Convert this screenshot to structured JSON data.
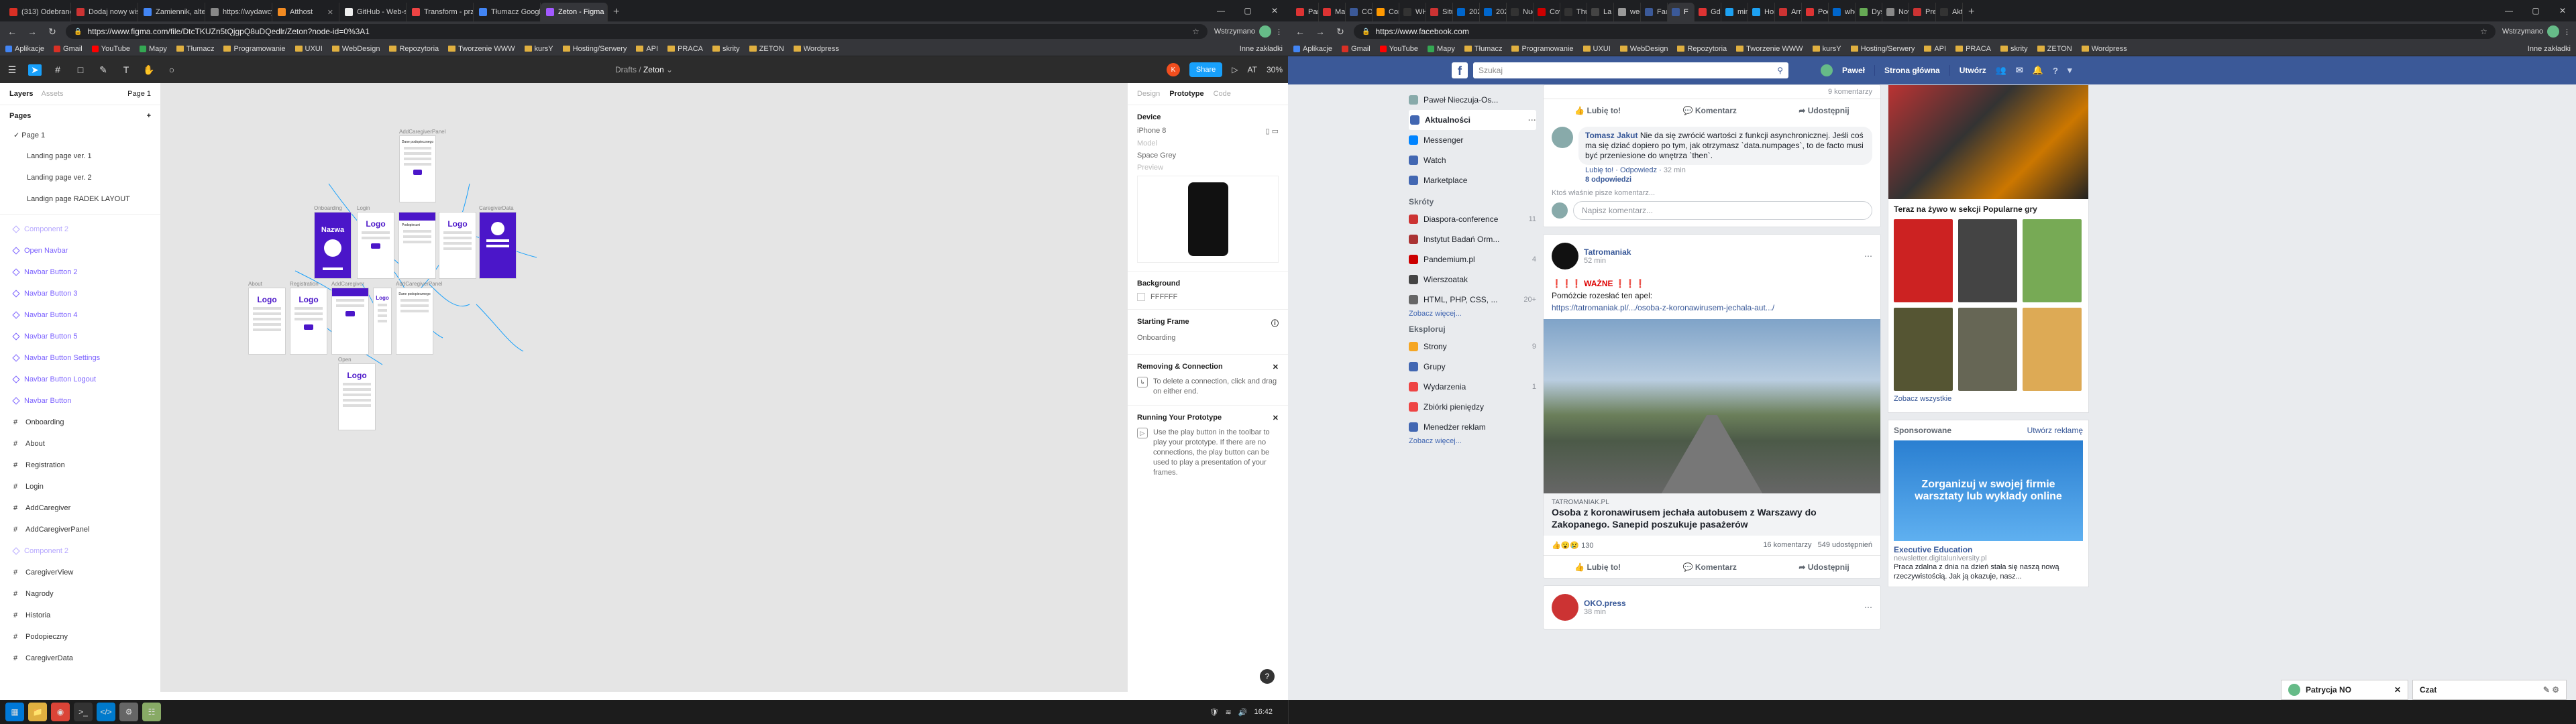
{
  "left_browser": {
    "tabs": [
      {
        "label": "(313) Odebrane - Listy",
        "color": "#d93025"
      },
      {
        "label": "Dodaj nowy wiś • Pas",
        "color": "#c33"
      },
      {
        "label": "Zamiennik, alternatyw",
        "color": "#4285f4"
      },
      {
        "label": "https://wydawcy.panel",
        "color": "#888"
      },
      {
        "label": "Atthost",
        "color": "#f28b22"
      },
      {
        "label": "GitHub - Web-skirport",
        "color": "#eee"
      },
      {
        "label": "Transform - przekszta",
        "color": "#e44"
      },
      {
        "label": "Tłumacz Google",
        "color": "#4285f4"
      },
      {
        "label": "Zeton - Figma",
        "color": "#a259ff",
        "active": true
      }
    ],
    "url": "https://www.figma.com/file/DtcTKUZn5tQjgpQ8uDQedlr/Zeton?node-id=0%3A1",
    "profile_label": "Wstrzymano",
    "bookmarks": [
      "Aplikacje",
      "Gmail",
      "YouTube",
      "Mapy",
      "Tłumacz",
      "Programowanie",
      "UXUI",
      "WebDesign",
      "Repozytoria",
      "Tworzenie WWW",
      "kursY",
      "Hosting/Serwery",
      "API",
      "PRACA",
      "skrity",
      "ZETON",
      "Wordpress"
    ],
    "bookmarks_right": "Inne zakładki"
  },
  "figma": {
    "breadcrumb_parent": "Drafts",
    "breadcrumb_current": "Zeton",
    "avatar_initial": "K",
    "share_label": "Share",
    "user_initials": "AT",
    "zoom": "30%",
    "layers_tab": "Layers",
    "assets_tab": "Assets",
    "page_selector": "Page 1",
    "pages_heading": "Pages",
    "pages": [
      "Page 1",
      "Landing page ver. 1",
      "Landing page ver. 2",
      "Landign page RADEK LAYOUT"
    ],
    "layers": [
      {
        "label": "Component 2",
        "type": "comp-dim"
      },
      {
        "label": "Open Navbar",
        "type": "comp"
      },
      {
        "label": "Navbar Button 2",
        "type": "comp"
      },
      {
        "label": "Navbar Button 3",
        "type": "comp"
      },
      {
        "label": "Navbar Button 4",
        "type": "comp"
      },
      {
        "label": "Navbar Button 5",
        "type": "comp"
      },
      {
        "label": "Navbar Button Settings",
        "type": "comp"
      },
      {
        "label": "Navbar Button Logout",
        "type": "comp"
      },
      {
        "label": "Navbar Button",
        "type": "comp"
      },
      {
        "label": "Onboarding",
        "type": "frame"
      },
      {
        "label": "About",
        "type": "frame"
      },
      {
        "label": "Registration",
        "type": "frame"
      },
      {
        "label": "Login",
        "type": "frame"
      },
      {
        "label": "AddCaregiver",
        "type": "frame"
      },
      {
        "label": "AddCaregiverPanel",
        "type": "frame"
      },
      {
        "label": "Component 2",
        "type": "comp-dim"
      },
      {
        "label": "CaregiverView",
        "type": "frame"
      },
      {
        "label": "Nagrody",
        "type": "frame"
      },
      {
        "label": "Historia",
        "type": "frame"
      },
      {
        "label": "Podopieczny",
        "type": "frame"
      },
      {
        "label": "CaregiverData",
        "type": "frame"
      }
    ],
    "right_tabs": [
      "Design",
      "Prototype",
      "Code"
    ],
    "device_heading": "Device",
    "device": "iPhone 8",
    "model_label": "Model",
    "model_value": "Space Grey",
    "preview_label": "Preview",
    "background_heading": "Background",
    "background_value": "FFFFFF",
    "starting_frame_heading": "Starting Frame",
    "starting_frame_value": "Onboarding",
    "removing_heading": "Removing & Connection",
    "removing_text": "To delete a connection, click and drag on either end.",
    "running_heading": "Running Your Prototype",
    "running_text": "Use the play button in the toolbar to play your prototype. If there are no connections, the play button can be used to play a presentation of your frames.",
    "frame_labels": {
      "onboarding": "Onboarding",
      "login": "Login",
      "caregiver_data": "CaregiverData",
      "about": "About",
      "registration": "Registration",
      "add_caregiver": "AddCaregiver",
      "add_caregiver_panel": "AddCaregiverPanel",
      "add_caregiver_panel_top": "AddCaregiverPanel",
      "open_navbar": "Open"
    },
    "frame_texts": {
      "nazwa": "Nazwa",
      "logo": "Logo",
      "podopieczni": "Podopieczni",
      "dane": "Dane podopiecznego"
    }
  },
  "taskbar": {
    "time": "16:42",
    "apps": [
      "start",
      "files",
      "chrome",
      "terminal",
      "vscode",
      "explorer",
      "settings"
    ]
  },
  "right_browser": {
    "tabs": [
      {
        "label": "Pan",
        "color": "#d33"
      },
      {
        "label": "Mar",
        "color": "#d33"
      },
      {
        "label": "COV",
        "color": "#3b5998"
      },
      {
        "label": "Cor",
        "color": "#f90"
      },
      {
        "label": "WH",
        "color": "#333"
      },
      {
        "label": "Situ",
        "color": "#c33"
      },
      {
        "label": "202",
        "color": "#06c"
      },
      {
        "label": "202",
        "color": "#06c"
      },
      {
        "label": "Nuo",
        "color": "#333"
      },
      {
        "label": "Cov",
        "color": "#c00"
      },
      {
        "label": "Thu",
        "color": "#333"
      },
      {
        "label": "La h",
        "color": "#444"
      },
      {
        "label": "wee",
        "color": "#999"
      },
      {
        "label": "Fac",
        "color": "#3b5998"
      },
      {
        "label": "F",
        "color": "#3b5998",
        "active": true
      },
      {
        "label": "Gdz",
        "color": "#d33"
      },
      {
        "label": "min",
        "color": "#1da1f2"
      },
      {
        "label": "Hon",
        "color": "#1da1f2"
      },
      {
        "label": "Arm",
        "color": "#c33"
      },
      {
        "label": "Pod",
        "color": "#d33"
      },
      {
        "label": "who",
        "color": "#06c"
      },
      {
        "label": "Dys",
        "color": "#6a5"
      },
      {
        "label": "Nowa k",
        "color": "#888"
      },
      {
        "label": "Prer",
        "color": "#c33"
      },
      {
        "label": "Akt",
        "color": "#333"
      }
    ],
    "url": "https://www.facebook.com",
    "profile_label": "Wstrzymano",
    "bookmarks": [
      "Aplikacje",
      "Gmail",
      "YouTube",
      "Mapy",
      "Tłumacz",
      "Programowanie",
      "UXUI",
      "WebDesign",
      "Repozytoria",
      "Tworzenie WWW",
      "kursY",
      "Hosting/Serwery",
      "API",
      "PRACA",
      "skrity",
      "ZETON",
      "Wordpress"
    ],
    "bookmarks_right": "Inne zakładki"
  },
  "facebook": {
    "search_placeholder": "Szukaj",
    "nav": [
      "Paweł",
      "Strona główna",
      "Utwórz"
    ],
    "left_menu": [
      {
        "label": "Paweł Nieczuja-Os...",
        "color": "#8aa"
      },
      {
        "label": "Aktualności",
        "color": "#4267b2",
        "active": true
      },
      {
        "label": "Messenger",
        "color": "#0084ff"
      },
      {
        "label": "Watch",
        "color": "#4267b2"
      },
      {
        "label": "Marketplace",
        "color": "#4267b2"
      }
    ],
    "shortcuts_heading": "Skróty",
    "shortcuts": [
      {
        "label": "Diaspora-conference",
        "count": "11",
        "color": "#c33"
      },
      {
        "label": "Instytut Badań Orm...",
        "count": "",
        "color": "#a33"
      },
      {
        "label": "Pandemium.pl",
        "count": "4",
        "color": "#c00"
      },
      {
        "label": "Wierszoatak",
        "count": "",
        "color": "#444"
      },
      {
        "label": "HTML, PHP, CSS, ...",
        "count": "20+",
        "color": "#666"
      }
    ],
    "see_more": "Zobacz więcej...",
    "explore_heading": "Eksploruj",
    "explore": [
      {
        "label": "Strony",
        "count": "9",
        "color": "#f5a623"
      },
      {
        "label": "Grupy",
        "count": "",
        "color": "#4267b2"
      },
      {
        "label": "Wydarzenia",
        "count": "1",
        "color": "#e44"
      },
      {
        "label": "Zbiórki pieniędzy",
        "count": "",
        "color": "#e44"
      },
      {
        "label": "Menedżer reklam",
        "count": "",
        "color": "#4267b2"
      }
    ],
    "see_more2": "Zobacz więcej...",
    "comments_count": "9 komentarzy",
    "like": "Lubię to!",
    "comment": "Komentarz",
    "share": "Udostępnij",
    "comment_author": "Tomasz Jakut",
    "comment_text": "Nie da się zwrócić wartości z funkcji asynchronicznej. Jeśli coś ma się dziać dopiero po tym, jak otrzymasz `data.numpages`, to de facto musi być przeniesione do wnętrza `then`.",
    "comment_meta_like": "Lubię to!",
    "comment_meta_reply": "Odpowiedz",
    "comment_meta_time": "32 min",
    "replies": "8 odpowiedzi",
    "who_writing": "Ktoś właśnie pisze komentarz...",
    "write_placeholder": "Napisz komentarz...",
    "post2_author": "Tatromaniak",
    "post2_time": "52 min",
    "post2_alert": "WAŻNE",
    "post2_text": "Pomóżcie rozesłać ten apel:",
    "post2_link": "https://tatromaniak.pl/.../osoba-z-koronawirusem-jechala-aut.../",
    "link_source": "TATROMANIAK.PL",
    "link_title": "Osoba z koronawirusem jechała autobusem z Warszawy do Zakopanego. Sanepid poszukuje pasażerów",
    "reactions": "130",
    "comments2": "16 komentarzy",
    "shares2": "549 udostępnień",
    "post3_author": "OKO.press",
    "post3_time": "38 min",
    "live_heading": "Teraz na żywo w sekcji Popularne gry",
    "see_all": "Zobacz wszystkie",
    "sponsored": "Sponsorowane",
    "create_ad": "Utwórz reklamę",
    "ad_image_text": "Zorganizuj w swojej firmie warsztaty lub wykłady online",
    "ad_title": "Executive Education",
    "ad_site": "newsletter.digitaluniversity.pl",
    "ad_text": "Praca zdalna z dnia na dzień stała się naszą nową rzeczywistością. Jak ją okazuje, nasz...",
    "chat_person": "Patrycja NO",
    "chat_label": "Czat"
  }
}
